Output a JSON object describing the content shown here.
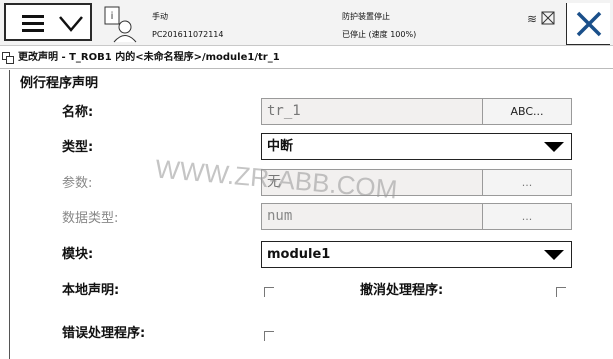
{
  "header": {
    "status_line1": "手动",
    "status_line2": "PC201611072114",
    "status_line3": "防护装置停止",
    "status_line4": "已停止 (速度 100%)",
    "icons": [
      "menu-icon",
      "chevron-down-icon",
      "user-info-icon",
      "status-icon",
      "close-icon"
    ]
  },
  "breadcrumb": {
    "text": "更改声明 - T_ROB1 内的<未命名程序>/module1/tr_1"
  },
  "form": {
    "section_title": "例行程序声明",
    "name_label": "名称:",
    "name_value": "tr_1",
    "name_button": "ABC...",
    "type_label": "类型:",
    "type_value": "中断",
    "params_label": "参数:",
    "params_value": "无",
    "params_button": "...",
    "datatype_label": "数据类型:",
    "datatype_value": "num",
    "datatype_button": "...",
    "module_label": "模块:",
    "module_value": "module1",
    "local_label": "本地声明:",
    "local_checked": false,
    "undo_label": "撤消处理程序:",
    "undo_checked": false,
    "error_label": "错误处理程序:",
    "error_checked": false
  },
  "watermark": "WWW.ZR-ABB.COM"
}
